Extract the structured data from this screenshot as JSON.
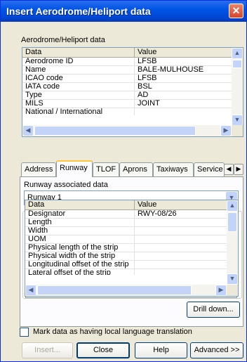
{
  "window": {
    "title": "Insert Aerodrome/Heliport data"
  },
  "top_group": {
    "label": "Aerodrome/Heliport data",
    "columns": [
      "Data",
      "Value"
    ],
    "rows": [
      {
        "data": "Aerodrome ID",
        "value": "LFSB"
      },
      {
        "data": "Name",
        "value": "BALE-MULHOUSE"
      },
      {
        "data": "ICAO code",
        "value": "LFSB"
      },
      {
        "data": "IATA code",
        "value": "BSL"
      },
      {
        "data": "Type",
        "value": "AD"
      },
      {
        "data": "MILS",
        "value": "JOINT"
      },
      {
        "data": "National / International",
        "value": ""
      }
    ]
  },
  "tabs": [
    "Address",
    "Runway",
    "TLOF",
    "Aprons",
    "Taxiways",
    "Service"
  ],
  "active_tab": "Runway",
  "runway_panel": {
    "combo_label": "Runway associated data",
    "combo_value": "Runway 1",
    "columns": [
      "Data",
      "Value"
    ],
    "rows": [
      {
        "data": "Designator",
        "value": "RWY-08/26"
      },
      {
        "data": "Length",
        "value": ""
      },
      {
        "data": "Width",
        "value": ""
      },
      {
        "data": "UOM",
        "value": ""
      },
      {
        "data": "Physical length of the strip",
        "value": ""
      },
      {
        "data": "Physical width of the strip",
        "value": ""
      },
      {
        "data": "Longitudinal offset of the strip",
        "value": ""
      },
      {
        "data": "Lateral offset of the strip",
        "value": ""
      }
    ],
    "drill_down_label": "Drill down..."
  },
  "checkbox": {
    "label": "Mark data as having local language translation",
    "checked": false
  },
  "buttons": {
    "insert": "Insert...",
    "close": "Close",
    "help": "Help",
    "advanced": "Advanced >>"
  },
  "icons": {
    "close": "close-icon",
    "arrows": [
      "up-arrow-icon",
      "down-arrow-icon",
      "left-arrow-icon",
      "right-arrow-icon",
      "dropdown-arrow-icon"
    ]
  }
}
